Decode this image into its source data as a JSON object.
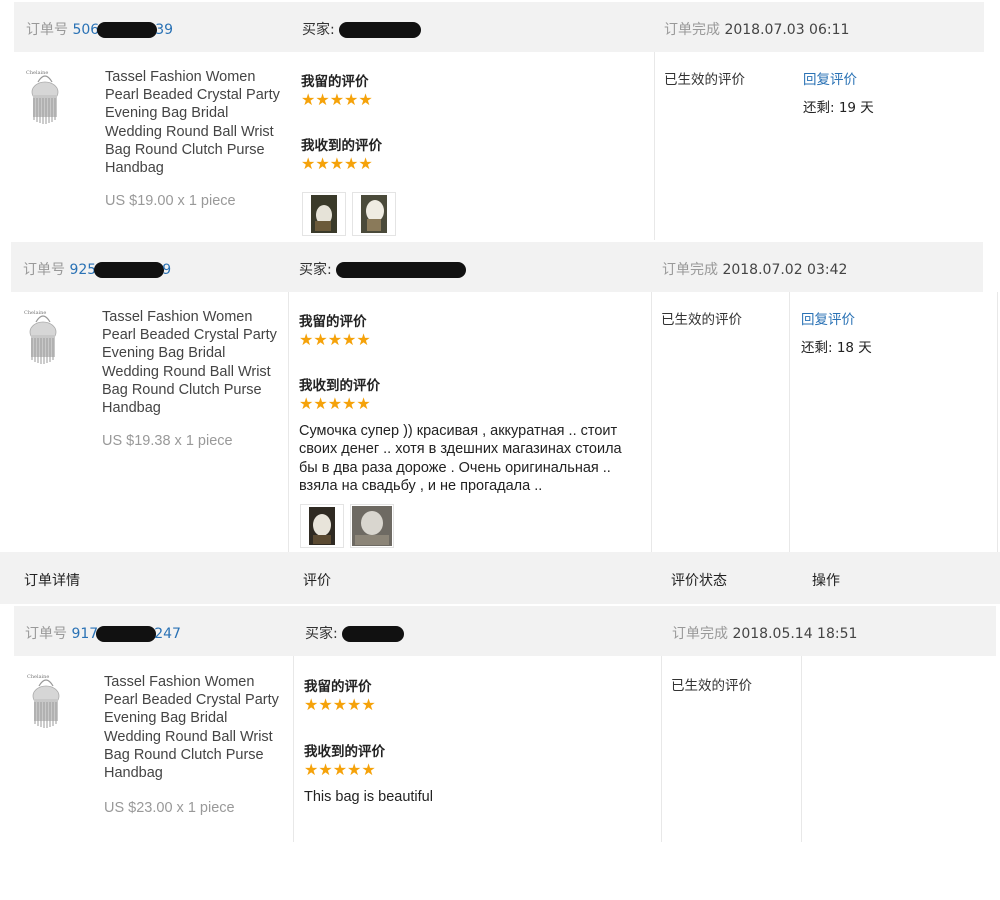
{
  "orders": [
    {
      "order_label": "订单号",
      "order_no_prefix": "506",
      "order_no_suffix": "39",
      "buyer_label": "买家:",
      "status_label": "订单完成",
      "date": "2018.07.03 06:11",
      "product_title": "Tassel Fashion Women Pearl Beaded Crystal Party Evening Bag Bridal Wedding Round Ball Wrist Bag Round Clutch Purse Handbag",
      "price": "US $19.00 x 1 piece",
      "my_review_label": "我留的评价",
      "my_stars": 5,
      "received_review_label": "我收到的评价",
      "received_stars": 5,
      "review_text": "",
      "photo_count": 2,
      "review_status": "已生效的评价",
      "reply_link": "回复评价",
      "remaining": "还剩:  19 天"
    },
    {
      "order_label": "订单号",
      "order_no_prefix": "925",
      "order_no_suffix": "9",
      "buyer_label": "买家:",
      "status_label": "订单完成",
      "date": "2018.07.02 03:42",
      "product_title": "Tassel Fashion Women Pearl Beaded Crystal Party Evening Bag Bridal Wedding Round Ball Wrist Bag Round Clutch Purse Handbag",
      "price": "US $19.38 x 1 piece",
      "my_review_label": "我留的评价",
      "my_stars": 5,
      "received_review_label": "我收到的评价",
      "received_stars": 5,
      "review_text": "Сумочка супер )) красивая , аккуратная .. стоит своих денег .. хотя в здешних магазинах стоила бы в два раза дороже . Очень оригинальная .. взяла на свадьбу , и не прогадала ..",
      "photo_count": 2,
      "review_status": "已生效的评价",
      "reply_link": "回复评价",
      "remaining": "还剩:  18 天"
    },
    {
      "order_label": "订单号",
      "order_no_prefix": "917",
      "order_no_suffix": "247",
      "buyer_label": "买家:",
      "status_label": "订单完成",
      "date": "2018.05.14 18:51",
      "product_title": "Tassel Fashion Women Pearl Beaded Crystal Party Evening Bag Bridal Wedding Round Ball Wrist Bag Round Clutch Purse Handbag",
      "price": "US $23.00 x 1 piece",
      "my_review_label": "我留的评价",
      "my_stars": 5,
      "received_review_label": "我收到的评价",
      "received_stars": 5,
      "review_text": "This bag is beautiful",
      "photo_count": 0,
      "review_status": "已生效的评价",
      "reply_link": "",
      "remaining": ""
    }
  ],
  "table_header": {
    "order_details": "订单详情",
    "review": "评价",
    "review_status": "评价状态",
    "actions": "操作"
  },
  "colors": {
    "link": "#2a72b5",
    "star": "#f5a20a",
    "header_bg": "#f2f2f2",
    "muted": "#999999"
  },
  "icons": {
    "star": "star-icon",
    "product": "tassel-bag-thumbnail-icon",
    "photo": "review-photo-icon"
  }
}
